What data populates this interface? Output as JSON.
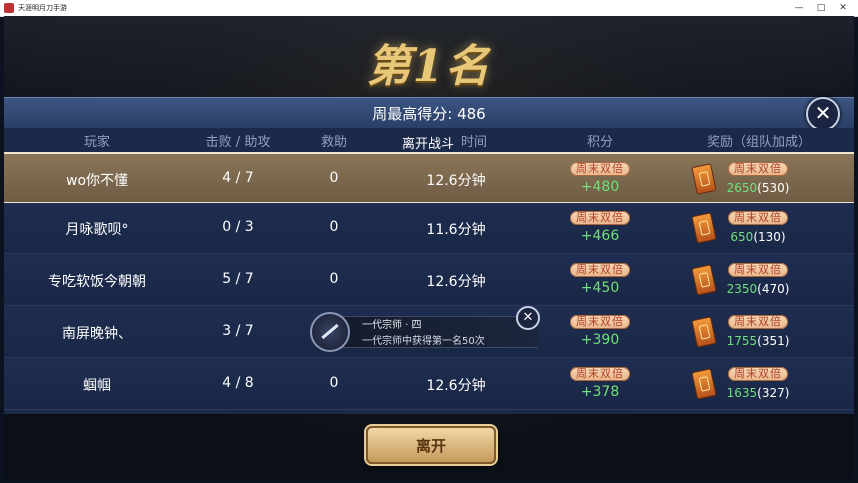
{
  "window": {
    "title": "天涯明月刀手游",
    "controls": [
      "—",
      "□",
      "✕"
    ]
  },
  "rank_title": "第1名",
  "best_score": "周最高得分: 486",
  "close_icon": "✕",
  "headers": {
    "player": "玩家",
    "kd": "击败 / 助攻",
    "rescue": "救助",
    "time": "时间",
    "score": "积分",
    "reward": "奖励（组队加成）"
  },
  "leave_overlay": "离开战斗",
  "weekend_tag": "周末双倍",
  "rows": [
    {
      "name": "wo你不懂",
      "kd": "4 / 7",
      "rescue": "0",
      "time": "12.6分钟",
      "score": "+480",
      "reward": "2650",
      "bonus": "(530)",
      "me": true
    },
    {
      "name": "月咏歌呗°",
      "kd": "0 / 3",
      "rescue": "0",
      "time": "11.6分钟",
      "score": "+466",
      "reward": "650",
      "bonus": "(130)"
    },
    {
      "name": "专吃软饭今朝朝",
      "kd": "5 / 7",
      "rescue": "0",
      "time": "12.6分钟",
      "score": "+450",
      "reward": "2350",
      "bonus": "(470)"
    },
    {
      "name": "南屏晚钟、",
      "kd": "3 / 7",
      "rescue": "",
      "time": "",
      "score": "+390",
      "reward": "1755",
      "bonus": "(351)"
    },
    {
      "name": "蝈帼",
      "kd": "4 / 8",
      "rescue": "0",
      "time": "12.6分钟",
      "score": "+378",
      "reward": "1635",
      "bonus": "(327)"
    }
  ],
  "achievement": {
    "title": "一代宗师 · 四",
    "desc": "一代宗师中获得第一名50次"
  },
  "leave_button": "离开",
  "colors": {
    "accent_green": "#6fe07a",
    "gold": "#e8c878"
  }
}
